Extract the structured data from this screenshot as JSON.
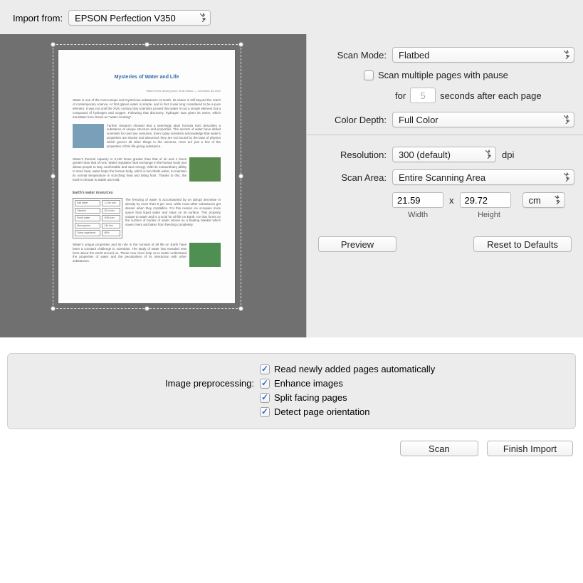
{
  "topbar": {
    "import_from_label": "Import from:",
    "scanner_selected": "EPSON Perfection V350"
  },
  "preview_doc": {
    "title": "Mysteries of Water and Life"
  },
  "settings": {
    "scan_mode_label": "Scan Mode:",
    "scan_mode_value": "Flatbed",
    "multi_page_label": "Scan multiple pages with pause",
    "for_label": "for",
    "pause_seconds": "5",
    "seconds_after_label": "seconds after each page",
    "color_depth_label": "Color Depth:",
    "color_depth_value": "Full Color",
    "resolution_label": "Resolution:",
    "resolution_value": "300 (default)",
    "dpi_label": "dpi",
    "scan_area_label": "Scan Area:",
    "scan_area_value": "Entire Scanning Area",
    "width_value": "21.59",
    "times": "x",
    "height_value": "29.72",
    "unit_value": "cm",
    "width_label": "Width",
    "height_label": "Height",
    "preview_btn": "Preview",
    "reset_btn": "Reset to Defaults"
  },
  "bottom": {
    "read_auto_label": "Read newly added pages automatically",
    "preprocessing_label": "Image preprocessing:",
    "enhance_label": "Enhance images",
    "split_label": "Split facing pages",
    "detect_label": "Detect page orientation"
  },
  "footer": {
    "scan_btn": "Scan",
    "finish_btn": "Finish Import"
  }
}
